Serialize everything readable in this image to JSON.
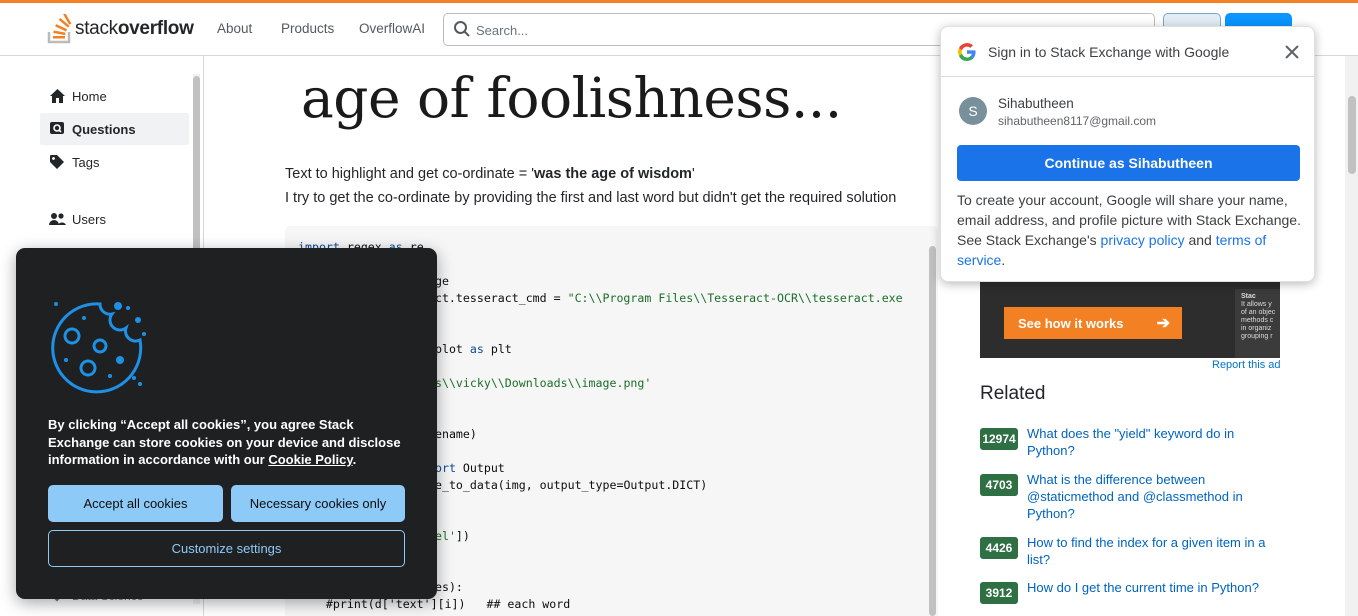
{
  "header": {
    "logo_text_regular": "stack",
    "logo_text_bold": "overflow",
    "nav": [
      "About",
      "Products",
      "OverflowAI"
    ],
    "search_placeholder": "Search..."
  },
  "sidebar": {
    "items": [
      {
        "label": "Home",
        "icon": "home-icon"
      },
      {
        "label": "Questions",
        "icon": "questions-icon"
      },
      {
        "label": "Tags",
        "icon": "tag-icon"
      },
      {
        "label": "Users",
        "icon": "users-icon"
      }
    ]
  },
  "main": {
    "image_text": "age of foolishness...",
    "para1_prefix": "Text to highlight and get co-ordinate = '",
    "para1_bold": "was the age of wisdom",
    "para1_suffix": "'",
    "para2": "I try to get the co-ordinate by providing the first and last word but didn't get the required solution",
    "code": {
      "l1_kw": "import",
      "l1_rest": " regex ",
      "l1_kw2": "as",
      "l1_rest2": " re",
      "l2": "ge",
      "l3_rest": "ract.tesseract_cmd = ",
      "l3_str": "\"C:\\\\Program Files\\\\Tesseract-OCR\\\\tesseract.exe",
      "l4": "yplot ",
      "l4_kw": "as",
      "l4_rest": " plt",
      "l5_str": "rs\\\\vicky\\\\Downloads\\\\image.png'",
      "l6": "iename)",
      "l7_kw": "port",
      "l7_rest": " Output",
      "l8": "ge_to_data(img, output_type=Output.DICT)",
      "l9_str": "vel'",
      "l9_rest": "])",
      "l10": "xes):",
      "l11": "    #print(d['text'][i])   ## each word"
    }
  },
  "related": {
    "title": "Related",
    "items": [
      {
        "score": "12974",
        "title": "What does the \"yield\" keyword do in Python?"
      },
      {
        "score": "4703",
        "title": "What is the difference between @staticmethod and @classmethod in Python?"
      },
      {
        "score": "4426",
        "title": "How to find the index for a given item in a list?"
      },
      {
        "score": "3912",
        "title": "How do I get the current time in Python?"
      }
    ]
  },
  "ad": {
    "cta": "See how it works",
    "side_title": "Stac",
    "side_text": "It allows y of an objec methods c in organiz grouping r",
    "report": "Report this ad"
  },
  "cookie": {
    "message_pre": "By clicking “Accept all cookies”, you agree Stack Exchange can store cookies on your device and disclose information in accordance with our ",
    "message_link": "Cookie Policy",
    "message_post": ".",
    "accept_all": "Accept all cookies",
    "necessary_only": "Necessary cookies only",
    "customize": "Customize settings",
    "accent": "#8ecaf8"
  },
  "google": {
    "title": "Sign in to Stack Exchange with Google",
    "avatar_letter": "S",
    "user_name": "Sihabutheen",
    "user_email": "sihabutheen8117@gmail.com",
    "continue": "Continue as Sihabutheen",
    "notice_pre": "To create your account, Google will share your name, email address, and profile picture with Stack Exchange. See Stack Exchange's ",
    "privacy": "privacy policy",
    "and": " and ",
    "terms": "terms of service",
    "notice_post": ".",
    "button_color": "#1a73e8"
  },
  "partial_text": {
    "sidebar_bottom": "Data Science"
  }
}
